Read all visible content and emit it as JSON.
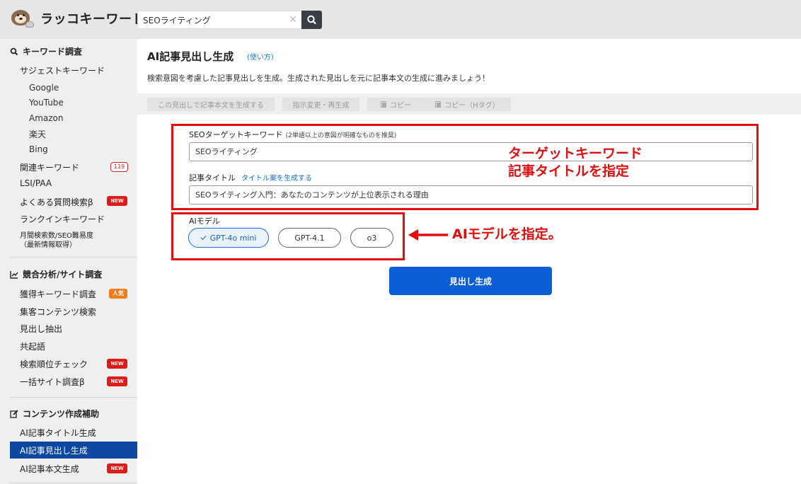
{
  "header": {
    "logo_text": "ラッコキーワード",
    "search": {
      "value": "SEOライティング",
      "placeholder": ""
    },
    "clear_glyph": "✕"
  },
  "sidebar": {
    "keyword_section": {
      "title": "キーワード調査",
      "suggest": "サジェストキーワード",
      "suggest_items": [
        "Google",
        "YouTube",
        "Amazon",
        "楽天",
        "Bing"
      ],
      "related": "関連キーワード",
      "related_count": "119",
      "lsi": "LSI/PAA",
      "faq": "よくある質問検索β",
      "rankin": "ランクインキーワード",
      "volume_line1": "月間検索数/SEO難易度",
      "volume_line2": "（最新情報取得）"
    },
    "competitor_section": {
      "title": "競合分析/サイト調査",
      "acquired": "獲得キーワード調査",
      "content_search": "集客コンテンツ検索",
      "heading_extract": "見出し抽出",
      "cooccur": "共起語",
      "rank_check": "検索順位チェック",
      "bulk_site": "一括サイト調査β"
    },
    "content_section": {
      "title": "コンテンツ作成補助",
      "ai_title": "AI記事タイトル生成",
      "ai_heading": "AI記事見出し生成",
      "ai_body": "AI記事本文生成"
    },
    "badges": {
      "new": "NEW",
      "popular": "人気"
    }
  },
  "main": {
    "title": "AI記事見出し生成",
    "how_to": "(使い方)",
    "description": "検索意図を考慮した記事見出しを生成。生成された見出しを元に記事本文の生成に進みましょう！",
    "toolbar": {
      "generate_body": "この見出しで記事本文を生成する",
      "change_regen": "指示変更・再生成",
      "copy": "コピー",
      "copy_h": "コピー（Hタグ）"
    },
    "form": {
      "keyword_label": "SEOターゲットキーワード",
      "keyword_hint": "(2単語以上の意図が明確なものを推奨)",
      "keyword_value": "SEOライティング",
      "title_label": "記事タイトル",
      "title_link": "タイトル案を生成する",
      "title_value": "SEOライティング入門：あなたのコンテンツが上位表示される理由",
      "model_label": "AIモデル",
      "models": [
        "GPT-4o mini",
        "GPT-4.1",
        "o3"
      ],
      "selected_model": "GPT-4o mini",
      "generate_button": "見出し生成"
    }
  },
  "annotations": {
    "target_line1": "ターゲットキーワード",
    "target_line2": "記事タイトルを指定",
    "model_note": "AIモデルを指定。",
    "color": "#e20e0e"
  },
  "colors": {
    "accent": "#0b5ed7",
    "active_nav": "#0d47a1",
    "new_badge": "#e01a1a",
    "popular_badge": "#ef7d18"
  }
}
